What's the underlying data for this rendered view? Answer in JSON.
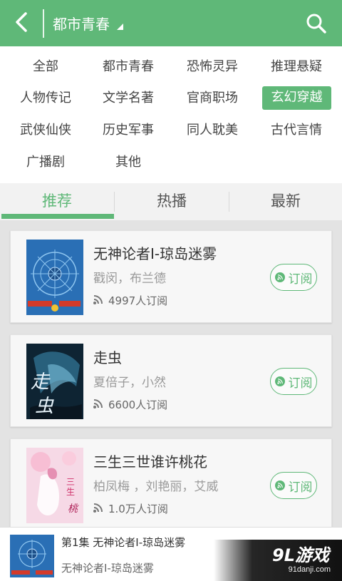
{
  "header": {
    "title": "都市青春",
    "icons": {
      "back": "chevron-left-icon",
      "search": "search-icon"
    }
  },
  "categories": [
    "全部",
    "都市青春",
    "恐怖灵异",
    "推理悬疑",
    "人物传记",
    "文学名著",
    "官商职场",
    "玄幻穿越",
    "武侠仙侠",
    "历史军事",
    "同人耽美",
    "古代言情",
    "广播剧",
    "其他"
  ],
  "active_category": "玄幻穿越",
  "tabs": {
    "recommend": "推荐",
    "hot": "热播",
    "latest": "最新"
  },
  "active_tab": "推荐",
  "books": [
    {
      "title": "无神论者Ⅰ-琼岛迷雾",
      "author": "戳闵，布兰德",
      "subs": "4997人订阅",
      "button": "订阅"
    },
    {
      "title": "走虫",
      "author": "夏倍子，小然",
      "subs": "6600人订阅",
      "button": "订阅"
    },
    {
      "title": "三生三世谁许桃花",
      "author": "柏凤梅 ，刘艳丽，艾威",
      "subs": "1.0万人订阅",
      "button": "订阅"
    }
  ],
  "player": {
    "episode": "第1集  无神论者Ⅰ-琼岛迷雾",
    "book": "无神论者Ⅰ-琼岛迷雾"
  },
  "watermark": {
    "logo": "9L游戏",
    "url": "91danji.com"
  },
  "colors": {
    "accent": "#5fb878",
    "header": "#5fb878"
  }
}
